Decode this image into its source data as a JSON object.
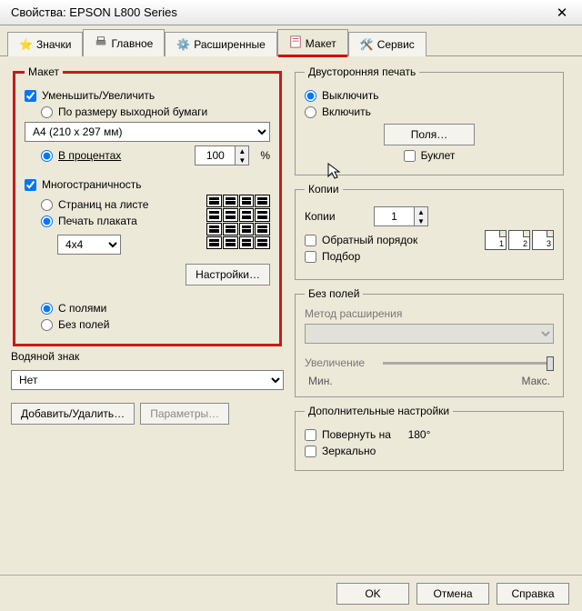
{
  "window": {
    "title": "Свойства: EPSON L800 Series"
  },
  "tabs": {
    "items": [
      {
        "label": "Значки"
      },
      {
        "label": "Главное"
      },
      {
        "label": "Расширенные"
      },
      {
        "label": "Макет"
      },
      {
        "label": "Сервис"
      }
    ],
    "active_index": 3
  },
  "layout": {
    "legend": "Макет",
    "reduce_enlarge": "Уменьшить/Увеличить",
    "by_output_paper": "По размеру выходной бумаги",
    "paper_select": "A4 (210 x 297 мм)",
    "by_percent": "В процентах",
    "percent_value": "100",
    "percent_sign": "%",
    "multipage": "Многостраничность",
    "pages_per_sheet": "Страниц на листе",
    "poster_print": "Печать плаката",
    "poster_size": "4x4",
    "settings_btn": "Настройки…",
    "with_margins": "С полями",
    "without_margins": "Без полей"
  },
  "watermark": {
    "label": "Водяной знак",
    "select_value": "Нет",
    "add_remove": "Добавить/Удалить…",
    "params": "Параметры…"
  },
  "duplex": {
    "legend": "Двусторонняя печать",
    "off": "Выключить",
    "on": "Включить",
    "margins_btn": "Поля…",
    "booklet": "Буклет"
  },
  "copies": {
    "legend": "Копии",
    "label": "Копии",
    "value": "1",
    "reverse": "Обратный порядок",
    "collate": "Подбор",
    "sheet_labels": [
      "1",
      "2",
      "3"
    ]
  },
  "borderless": {
    "legend": "Без полей",
    "method": "Метод расширения",
    "zoom": "Увеличение",
    "min": "Мин.",
    "max": "Макс."
  },
  "more": {
    "legend": "Дополнительные настройки",
    "rotate": "Повернуть на",
    "rotate_deg": "180°",
    "mirror": "Зеркально"
  },
  "footer": {
    "ok": "OK",
    "cancel": "Отмена",
    "help": "Справка"
  }
}
